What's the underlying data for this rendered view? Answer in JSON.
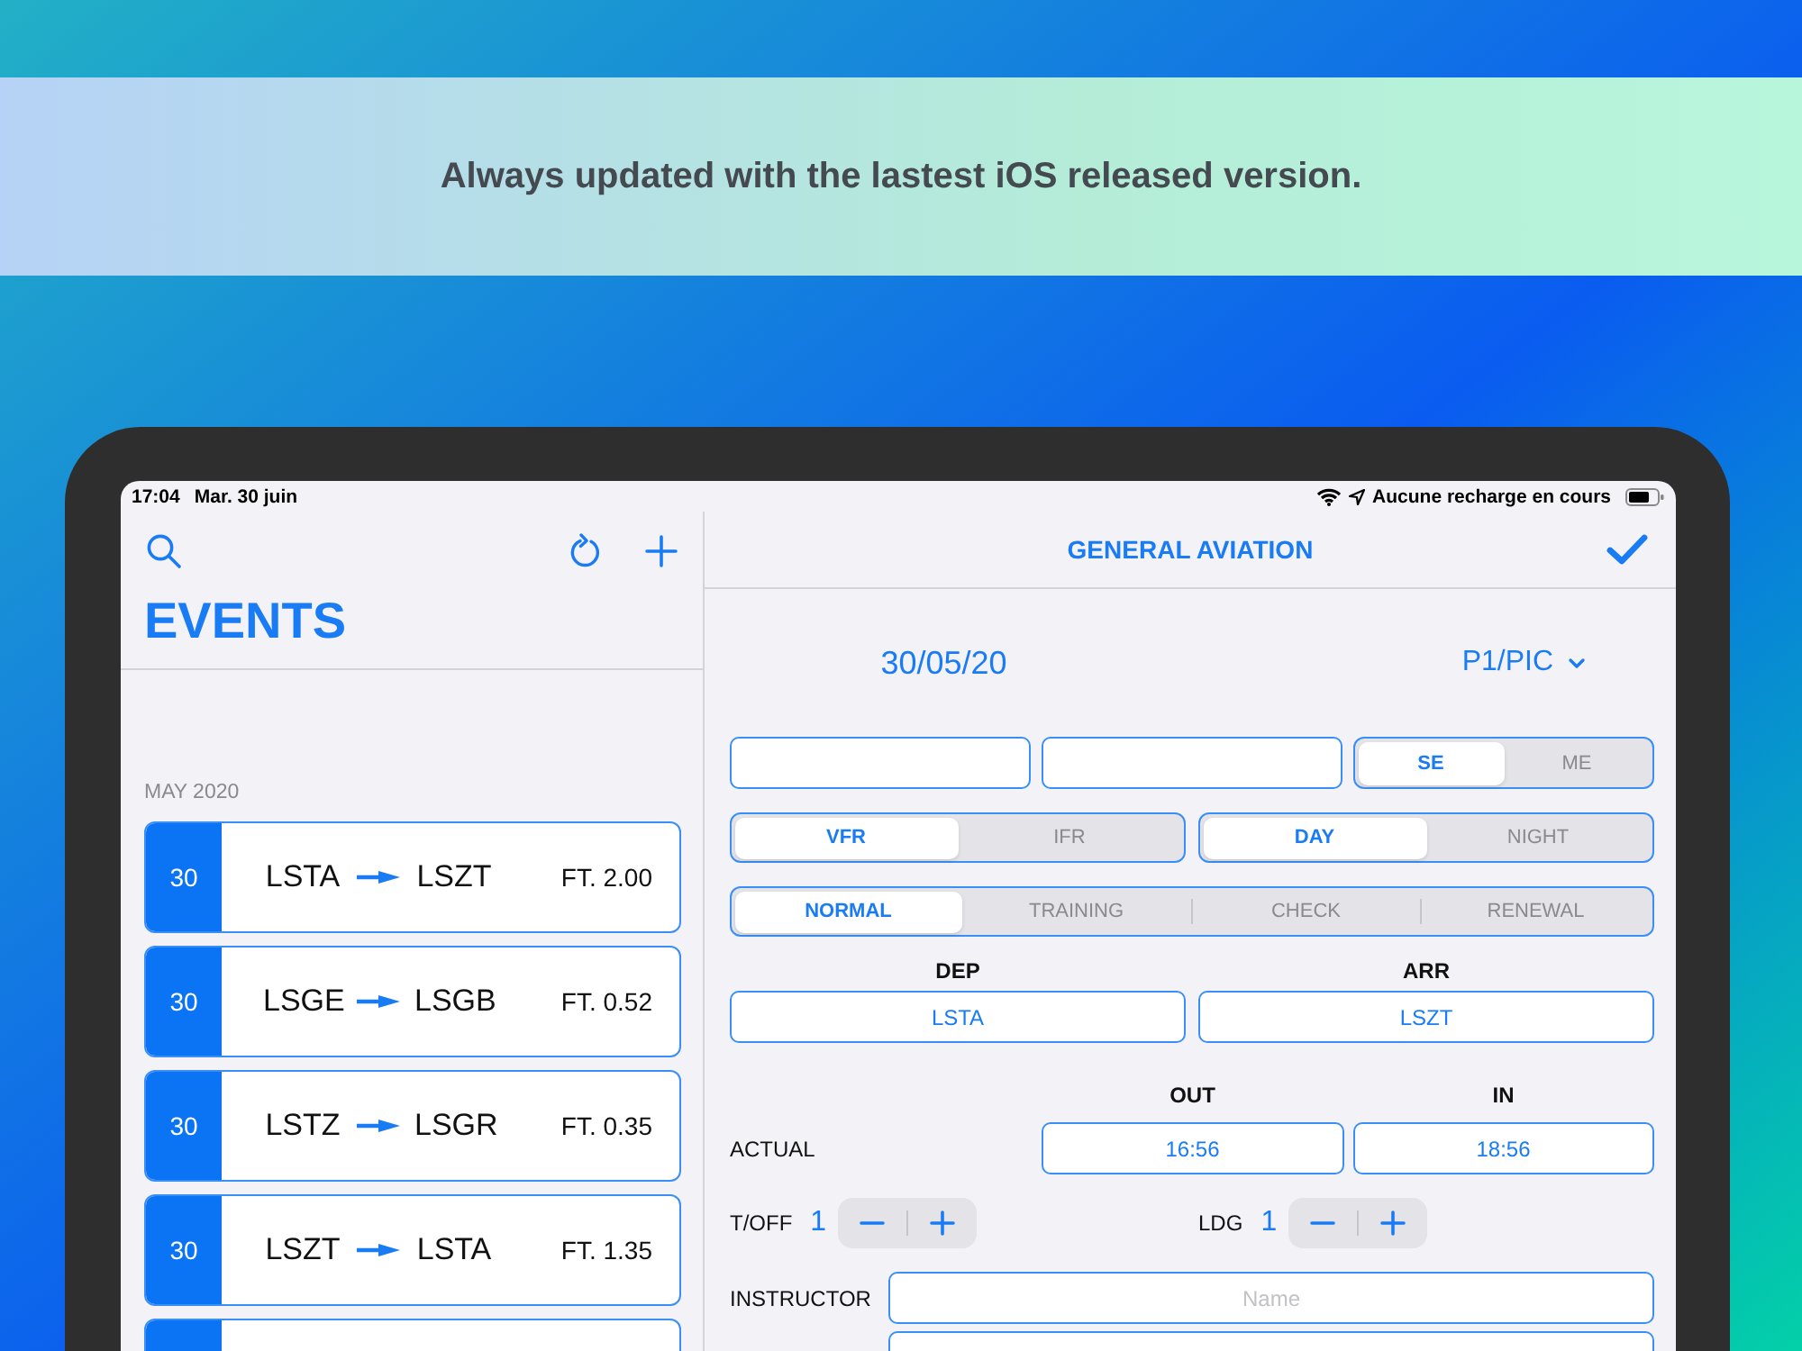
{
  "banner": {
    "caption": "Always updated with the lastest iOS released version."
  },
  "status_bar": {
    "time": "17:04",
    "date": "Mar. 30 juin",
    "charging": "Aucune recharge en cours"
  },
  "events_pane": {
    "title": "EVENTS",
    "section": "MAY 2020",
    "events": [
      {
        "day": "30",
        "from": "LSTA",
        "to": "LSZT",
        "flight_time": "FT. 2.00"
      },
      {
        "day": "30",
        "from": "LSGE",
        "to": "LSGB",
        "flight_time": "FT. 0.52"
      },
      {
        "day": "30",
        "from": "LSTZ",
        "to": "LSGR",
        "flight_time": "FT. 0.35"
      },
      {
        "day": "30",
        "from": "LSZT",
        "to": "LSTA",
        "flight_time": "FT. 1.35"
      }
    ]
  },
  "detail": {
    "title": "GENERAL AVIATION",
    "date": "30/05/20",
    "role": "P1/PIC",
    "engine": [
      {
        "label": "SE",
        "selected": true
      },
      {
        "label": "ME",
        "selected": false
      }
    ],
    "rules": [
      {
        "label": "VFR",
        "selected": true
      },
      {
        "label": "IFR",
        "selected": false
      }
    ],
    "light": [
      {
        "label": "DAY",
        "selected": true
      },
      {
        "label": "NIGHT",
        "selected": false
      }
    ],
    "purpose": [
      {
        "label": "NORMAL",
        "selected": true
      },
      {
        "label": "TRAINING",
        "selected": false
      },
      {
        "label": "CHECK",
        "selected": false
      },
      {
        "label": "RENEWAL",
        "selected": false
      }
    ],
    "airports": [
      {
        "label": "DEP",
        "value": "LSTA"
      },
      {
        "label": "ARR",
        "value": "LSZT"
      }
    ],
    "times": {
      "row_label": "ACTUAL",
      "columns": [
        {
          "label": "OUT",
          "value": "16:56"
        },
        {
          "label": "IN",
          "value": "18:56"
        }
      ]
    },
    "counters": [
      {
        "label": "T/OFF",
        "value": "1"
      },
      {
        "label": "LDG",
        "value": "1"
      }
    ],
    "instructor": {
      "label": "INSTRUCTOR",
      "placeholder": "Name"
    }
  }
}
